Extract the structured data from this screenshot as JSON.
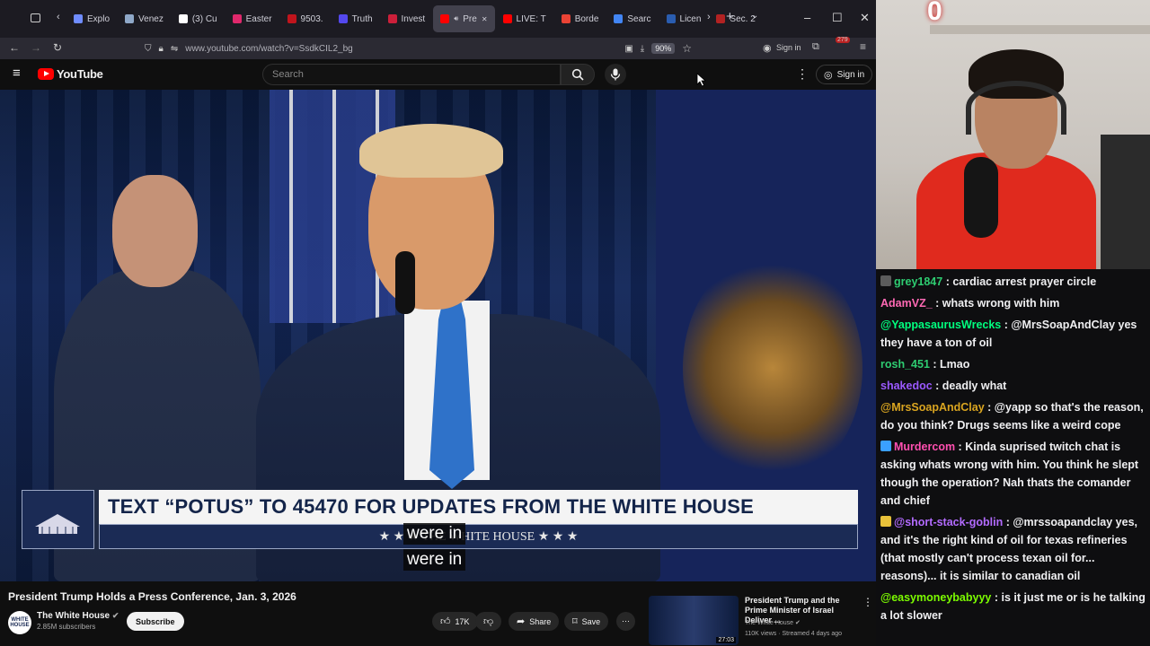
{
  "browser": {
    "tabs": [
      {
        "label": "Explo",
        "color": "#6f8cff",
        "active": false
      },
      {
        "label": "Venez",
        "color": "#8fa8c8",
        "active": false
      },
      {
        "label": "(3) Cu",
        "color": "#ffffff",
        "active": false
      },
      {
        "label": "Easter",
        "color": "#e0286c",
        "active": false
      },
      {
        "label": "9503.",
        "color": "#c0141c",
        "active": false
      },
      {
        "label": "Truth",
        "color": "#5448ee",
        "active": false
      },
      {
        "label": "Invest",
        "color": "#cc1f3a",
        "active": false
      },
      {
        "label": "Pre",
        "color": "#ff0000",
        "active": true
      },
      {
        "label": "LIVE: T",
        "color": "#ff0000",
        "active": false
      },
      {
        "label": "Borde",
        "color": "#ea4335",
        "active": false
      },
      {
        "label": "Searc",
        "color": "#4285f4",
        "active": false
      },
      {
        "label": "Licen",
        "color": "#2a5db0",
        "active": false
      },
      {
        "label": "Sec. 2",
        "color": "#b22222",
        "active": false
      }
    ],
    "url": "www.youtube.com/watch?v=SsdkCIL2_bg",
    "zoom": "90%",
    "signin": "Sign in",
    "extension_badge": "279"
  },
  "youtube": {
    "logo_text": "YouTube",
    "search_placeholder": "Search",
    "signin": "Sign in"
  },
  "video": {
    "banner_main": "TEXT “POTUS” TO 45470 FOR UPDATES FROM THE WHITE HOUSE",
    "banner_sub": "★ ★ ★   THE WHITE HOUSE   ★ ★ ★",
    "logo_caption": "THE WHITE HOUSE",
    "caption_line1": "were in",
    "caption_line2": "were in",
    "title": "President Trump Holds a Press Conference, Jan. 3, 2026",
    "channel_name": "The White House",
    "channel_avatar": "WHITE HOUSE",
    "subscribers": "2.85M subscribers",
    "subscribe_label": "Subscribe",
    "likes": "17K",
    "share_label": "Share",
    "save_label": "Save"
  },
  "recommended": {
    "title": "President Trump and the Prime Minister of Israel Deliver ...",
    "channel": "The White House",
    "meta": "110K views · Streamed 4 days ago",
    "duration": "27:03"
  },
  "webcam": {
    "overlay_number": "0"
  },
  "chat": [
    {
      "user": "grey1847",
      "color": "#2ecc71",
      "text": "cardiac arrest prayer circle",
      "badge": "#5c5c5c"
    },
    {
      "user": "AdamVZ_",
      "color": "#ff69b4",
      "text": "whats wrong with him",
      "badge": ""
    },
    {
      "user": "@YappasaurusWrecks",
      "color": "#00ff7f",
      "text": "@MrsSoapAndClay yes they have a ton of oil",
      "badge": ""
    },
    {
      "user": "rosh_451",
      "color": "#2ecc71",
      "text": "Lmao",
      "badge": ""
    },
    {
      "user": "shakedoc",
      "color": "#9b59ff",
      "text": "deadly what",
      "badge": ""
    },
    {
      "user": "@MrsSoapAndClay",
      "color": "#daa520",
      "text": "@yapp so that's the reason, do you think? Drugs seems like a weird cope",
      "badge": ""
    },
    {
      "user": "Murdercom",
      "color": "#ff4fb0",
      "text": "Kinda suprised twitch chat is asking whats wrong with him. You think he slept though the operation? Nah thats the comander and chief",
      "badge": "#3aa0ff"
    },
    {
      "user": "@short-stack-goblin",
      "color": "#b36bff",
      "text": "@mrssoapandclay yes, and it's the right kind of oil for texas refineries (that mostly can't process texan oil for... reasons)... it is similar to canadian oil",
      "badge": "#e8c13a"
    },
    {
      "user": "@easymoneybabyyy",
      "color": "#7cfc00",
      "text": "is it just me or is he talking a lot slower",
      "badge": ""
    }
  ]
}
